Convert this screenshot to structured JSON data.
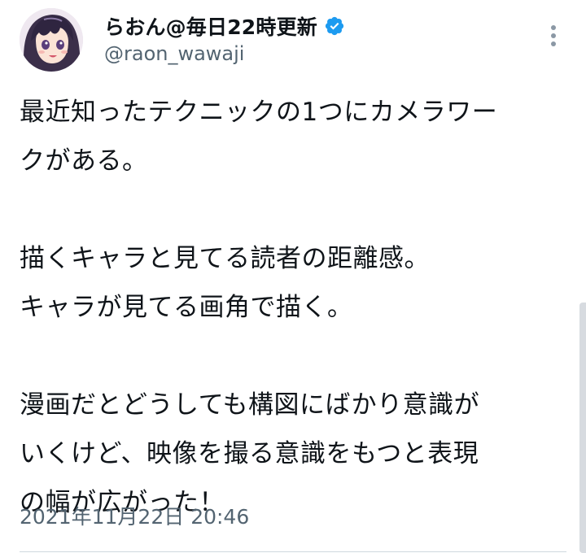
{
  "author": {
    "display_name": "らおん@毎日22時更新",
    "handle": "@raon_wawaji",
    "verified": true,
    "avatar_icon": "anime-girl-avatar"
  },
  "menu": {
    "icon": "more-vertical-icon"
  },
  "tweet": {
    "paragraphs": [
      "最近知ったテクニックの1つにカメラワー\nクがある。",
      "描くキャラと見てる読者の距離感。\nキャラが見てる画角で描く。",
      "漫画だとどうしても構図にばかり意識が\nいくけど、映像を撮る意識をもつと表現\nの幅が広がった！"
    ],
    "timestamp": "2021年11月22日 20:46"
  },
  "colors": {
    "text": "#0f1419",
    "secondary_text": "#536471",
    "verified_badge": "#1d9bf0",
    "divider": "#cfd9de"
  }
}
